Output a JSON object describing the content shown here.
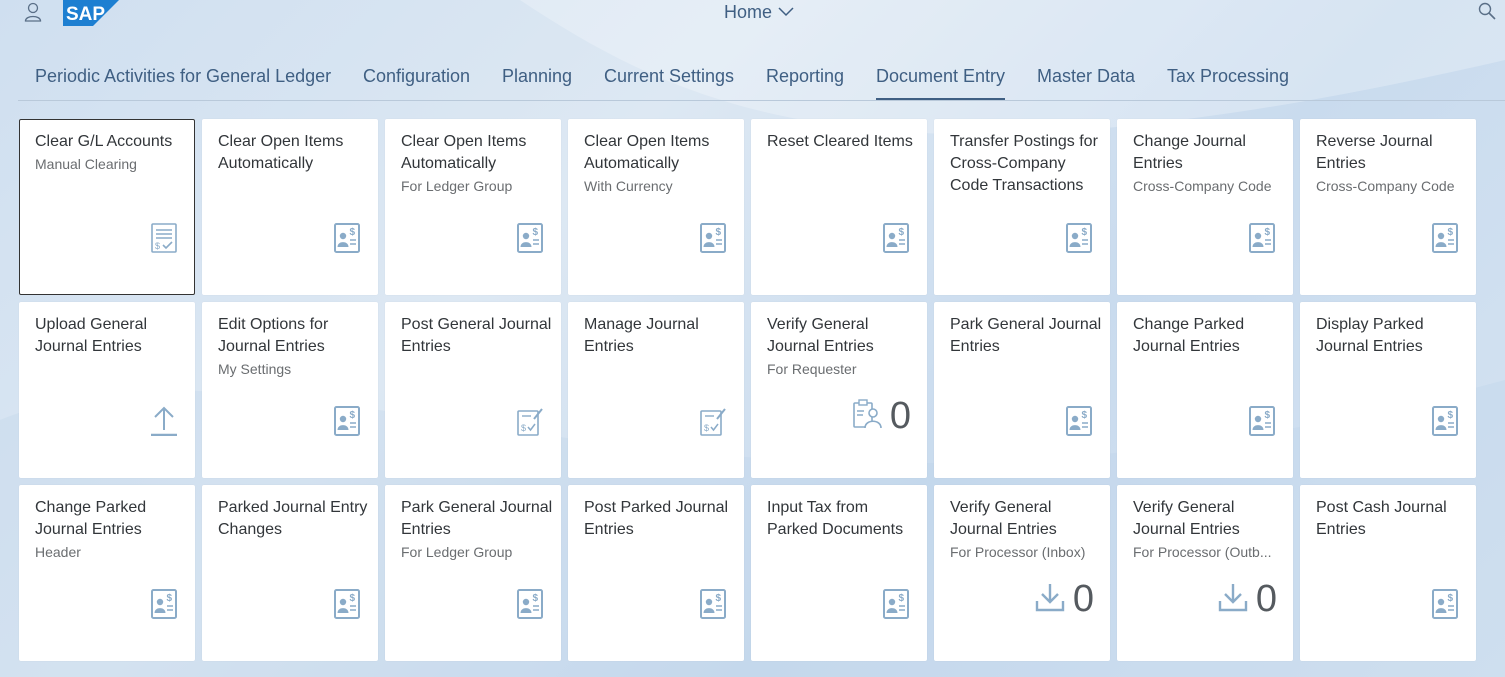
{
  "shell": {
    "logo_text": "SAP",
    "title": "Home",
    "colors": {
      "accent": "#3f5f83",
      "logo": "#1d7fd1",
      "icon": "#8aabc8"
    }
  },
  "tabs": [
    {
      "label": "Periodic Activities for General Ledger",
      "active": false
    },
    {
      "label": "Configuration",
      "active": false
    },
    {
      "label": "Planning",
      "active": false
    },
    {
      "label": "Current Settings",
      "active": false
    },
    {
      "label": "Reporting",
      "active": false
    },
    {
      "label": "Document Entry",
      "active": true
    },
    {
      "label": "Master Data",
      "active": false
    },
    {
      "label": "Tax Processing",
      "active": false
    }
  ],
  "tiles": [
    {
      "title": "Clear G/L Accounts",
      "subtitle": "Manual Clearing",
      "icon": "checklist-money-icon"
    },
    {
      "title": "Clear Open Items Automatically",
      "subtitle": "",
      "icon": "expense-report-icon"
    },
    {
      "title": "Clear Open Items Automatically",
      "subtitle": "For Ledger Group",
      "icon": "expense-report-icon"
    },
    {
      "title": "Clear Open Items Automatically",
      "subtitle": "With Currency",
      "icon": "expense-report-icon"
    },
    {
      "title": "Reset Cleared Items",
      "subtitle": "",
      "icon": "expense-report-icon"
    },
    {
      "title": "Transfer Postings for Cross-Company Code Transactions",
      "subtitle": "",
      "icon": "expense-report-icon"
    },
    {
      "title": "Change Journal Entries",
      "subtitle": "Cross-Company Code",
      "icon": "expense-report-icon"
    },
    {
      "title": "Reverse Journal Entries",
      "subtitle": "Cross-Company Code",
      "icon": "expense-report-icon"
    },
    {
      "title": "Upload General Journal Entries",
      "subtitle": "",
      "icon": "upload-icon"
    },
    {
      "title": "Edit Options for Journal Entries",
      "subtitle": "My Settings",
      "icon": "expense-report-icon"
    },
    {
      "title": "Post General Journal Entries",
      "subtitle": "",
      "icon": "money-document-edit-icon"
    },
    {
      "title": "Manage Journal Entries",
      "subtitle": "",
      "icon": "money-document-edit-icon"
    },
    {
      "title": "Verify General Journal Entries",
      "subtitle": "For Requester",
      "icon": "clipboard-user-icon",
      "kpi": "0"
    },
    {
      "title": "Park General Journal Entries",
      "subtitle": "",
      "icon": "expense-report-icon"
    },
    {
      "title": "Change Parked Journal Entries",
      "subtitle": "",
      "icon": "expense-report-icon"
    },
    {
      "title": "Display Parked Journal Entries",
      "subtitle": "",
      "icon": "expense-report-icon"
    },
    {
      "title": "Change Parked Journal Entries",
      "subtitle": "Header",
      "icon": "expense-report-icon"
    },
    {
      "title": "Parked Journal Entry Changes",
      "subtitle": "",
      "icon": "expense-report-icon"
    },
    {
      "title": "Park General Journal Entries",
      "subtitle": "For Ledger Group",
      "icon": "expense-report-icon"
    },
    {
      "title": "Post Parked Journal Entries",
      "subtitle": "",
      "icon": "expense-report-icon"
    },
    {
      "title": "Input Tax from Parked Documents",
      "subtitle": "",
      "icon": "expense-report-icon"
    },
    {
      "title": "Verify General Journal Entries",
      "subtitle": "For Processor (Inbox)",
      "icon": "download-icon",
      "kpi": "0"
    },
    {
      "title": "Verify General Journal Entries",
      "subtitle": "For Processor (Outb...",
      "icon": "download-icon",
      "kpi": "0"
    },
    {
      "title": "Post Cash Journal Entries",
      "subtitle": "",
      "icon": "expense-report-icon"
    }
  ]
}
